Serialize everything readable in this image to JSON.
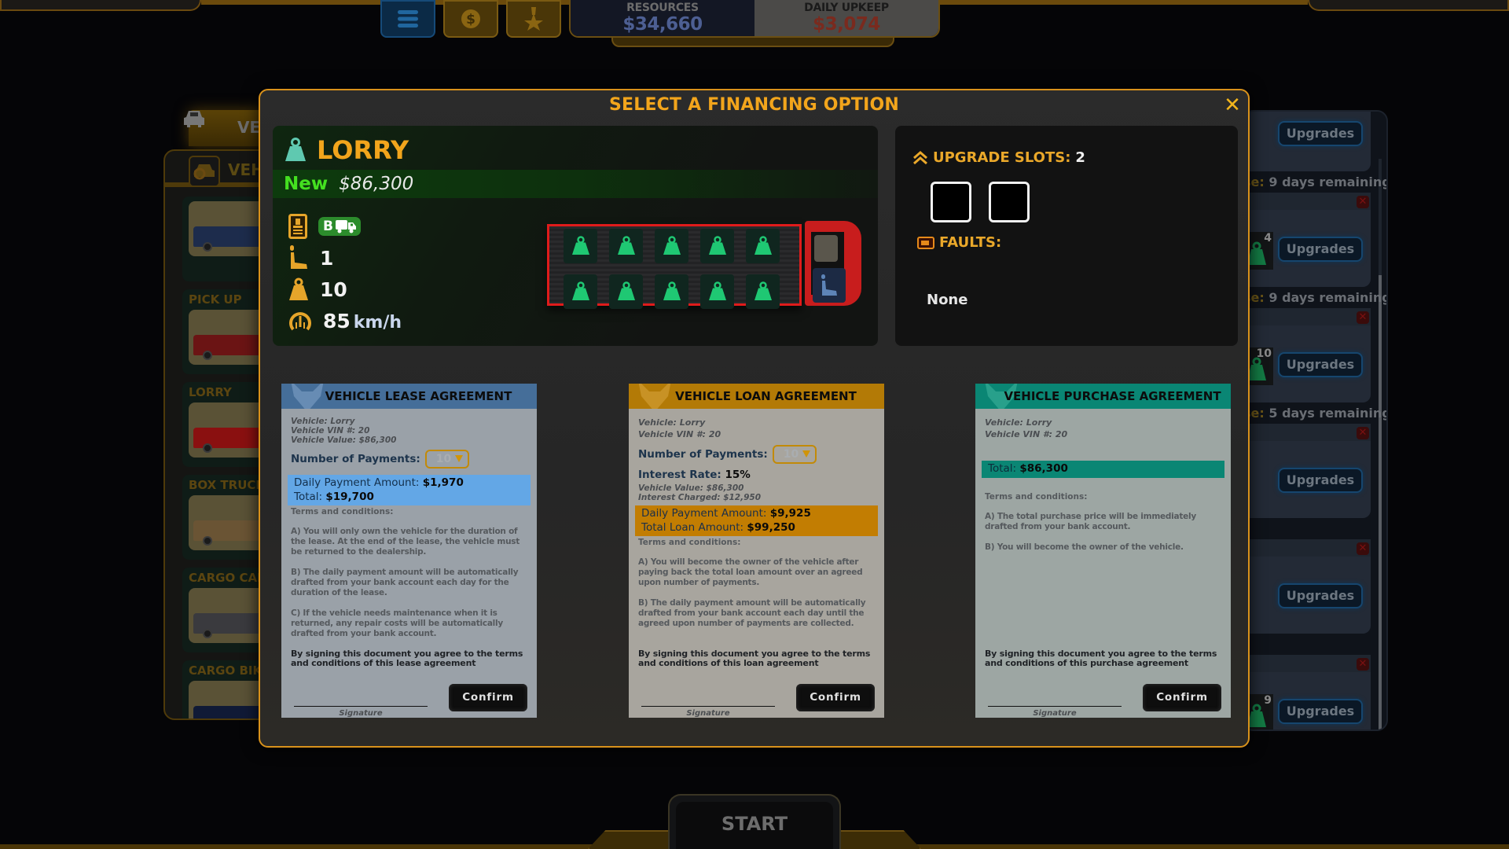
{
  "top_bar": {
    "nav_buttons": [
      {
        "name": "menu",
        "icon": "menu-icon",
        "active": true
      },
      {
        "name": "finance",
        "icon": "dollar-coin-icon",
        "active": false
      },
      {
        "name": "achievements",
        "icon": "star-medal-icon",
        "active": false
      }
    ],
    "resources_label": "RESOURCES",
    "resources_value": "$34,660",
    "upkeep_label": "DAILY UPKEEP",
    "upkeep_value": "$3,074"
  },
  "left_panel": {
    "tab_label": "VE",
    "header_label": "VEH",
    "categories": [
      {
        "label": "",
        "color": "#1d2c4c"
      },
      {
        "label": "PICK UP",
        "color": "#6b1414"
      },
      {
        "label": "LORRY",
        "color": "#8a1010"
      },
      {
        "label": "BOX TRUCK",
        "color": "#6a5434"
      },
      {
        "label": "CARGO CAR",
        "color": "#3a3a3e"
      },
      {
        "label": "CARGO BIKE",
        "color": "#101a36"
      }
    ]
  },
  "right_panel": {
    "fleet": [
      {
        "cargo_count": "",
        "upgrades_label": "Upgrades",
        "lease_label": "se:",
        "lease_text": "9 days remaining",
        "partial_top": true
      },
      {
        "cargo_count": "4",
        "upgrades_label": "Upgrades",
        "lease_label": "se:",
        "lease_text": "9 days remaining"
      },
      {
        "cargo_count": "10",
        "upgrades_label": "Upgrades",
        "lease_label": "se:",
        "lease_text": "5 days remaining"
      },
      {
        "cargo_count": "",
        "upgrades_label": "Upgrades",
        "lease_label": "",
        "lease_text": ""
      },
      {
        "cargo_count": "",
        "upgrades_label": "Upgrades",
        "lease_label": "",
        "lease_text": ""
      },
      {
        "cargo_count": "9",
        "upgrades_label": "Upgrades",
        "lease_label": "",
        "lease_text": ""
      }
    ]
  },
  "bottom": {
    "start_label": "START"
  },
  "modal": {
    "title": "SELECT A FINANCING OPTION",
    "close_icon": "close-icon",
    "vehicle": {
      "name": "LORRY",
      "condition": "New",
      "price": "$86,300",
      "license": "B",
      "seats": "1",
      "capacity": "10",
      "speed": "85",
      "speed_unit": "km/h",
      "cargo_slots_filled": 10,
      "driver_slots": 1,
      "colors": {
        "accent": "#f2a51c",
        "condition": "#44e020",
        "cargo": "#1fc873",
        "truck": "#e01b1b"
      }
    },
    "upgrades": {
      "label": "UPGRADE SLOTS:",
      "count": "2",
      "slots": [
        {
          "filled": false
        },
        {
          "filled": false
        }
      ],
      "faults_label": "FAULTS:",
      "faults_value": "None"
    },
    "agreements": {
      "lease": {
        "title": "VEHICLE LEASE AGREEMENT",
        "color": "#456e99",
        "vehicle": "Vehicle: Lorry",
        "vin": "Vehicle VIN #: 20",
        "value": "Vehicle Value: $86,300",
        "payments_label": "Number of Payments:",
        "payments_value": "10",
        "daily_label": "Daily Payment Amount:",
        "daily_value": "$1,970",
        "total_label": "Total:",
        "total_value": "$19,700",
        "terms_title": "Terms and conditions:",
        "terms": [
          " A) You will only own the vehicle for the duration of the lease. At the end of the lease, the vehicle must be returned to the dealership.",
          " B) The daily payment amount will be automatically drafted from your bank account each day for the duration of the lease.",
          " C) If the vehicle needs maintenance when it is returned, any repair costs will be automatically drafted from your bank account."
        ],
        "agree_text": "By signing this document you agree to the terms and conditions of this lease agreement",
        "signature_label": "Signature",
        "confirm_label": "Confirm"
      },
      "loan": {
        "title": "VEHICLE LOAN AGREEMENT",
        "color": "#b37a06",
        "vehicle": "Vehicle: Lorry",
        "vin": "Vehicle VIN #: 20",
        "payments_label": "Number of Payments:",
        "payments_value": "10",
        "interest_label": "Interest Rate:",
        "interest_value": "15%",
        "value": "Vehicle Value: $86,300",
        "interest_charged": "Interest Charged: $12,950",
        "daily_label": "Daily Payment Amount:",
        "daily_value": "$9,925",
        "total_label": "Total Loan Amount:",
        "total_value": "$99,250",
        "terms_title": "Terms and conditions:",
        "terms": [
          "A) You will become the owner of the vehicle after paying back the total loan amount over an agreed upon number of payments.",
          "B) The daily payment amount will be automatically drafted from your bank account each day until the agreed upon number of payments are collected."
        ],
        "agree_text": "By signing this document you agree to the terms and conditions of this loan agreement",
        "signature_label": "Signature",
        "confirm_label": "Confirm"
      },
      "purchase": {
        "title": "VEHICLE PURCHASE AGREEMENT",
        "color": "#0a8674",
        "vehicle": "Vehicle: Lorry",
        "vin": "Vehicle VIN #: 20",
        "total_label": "Total:",
        "total_value": "$86,300",
        "terms_title": "Terms and conditions:",
        "terms": [
          "A) The total purchase price will be immediately drafted from your bank account.",
          "B) You will become the owner of the vehicle."
        ],
        "agree_text": "By signing this document you agree to the terms and conditions of this purchase agreement",
        "signature_label": "Signature",
        "confirm_label": "Confirm"
      }
    }
  }
}
